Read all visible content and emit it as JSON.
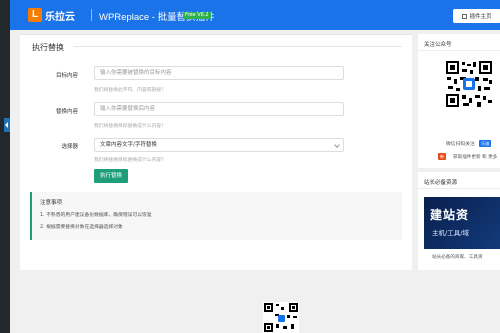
{
  "header": {
    "logo_mark": "L",
    "logo_text": "乐拉云",
    "title": "WPReplace - 批量替换插件",
    "version": "Free V6.2",
    "plugin_home_label": "插件主页"
  },
  "main": {
    "title": "执行替换",
    "fields": [
      {
        "label": "目标内容",
        "placeholder": "输入你需要被替换的目标内容",
        "hint": "我们将替换此字符、内容或链接？"
      },
      {
        "label": "替换内容",
        "placeholder": "输入你需要替换后内容",
        "hint": "我们将替换目标替换成什么内容？"
      }
    ],
    "selector": {
      "label": "选择器",
      "value": "文章内容文字/字符替换",
      "hint": "我们将替换目标替换成什么内容？"
    },
    "execute_label": "执行替换",
    "notice": {
      "title": "注意事项",
      "items": [
        "1. 不熟悉的用户建议备份数据库，确保错误可以恢复",
        "2. 根据需要替换对象在选择器选择对象"
      ]
    }
  },
  "sidebar": {
    "wechat": {
      "title": "关注公众号",
      "follow_text": "微信扫码关注",
      "follow_badge": "乐维",
      "new_tag": "新",
      "desc": "获取插件更新 和 更多"
    },
    "resources": {
      "title": "站长必备资源",
      "banner_big": "建站资",
      "banner_small": "主机/工具/域",
      "desc": "站长必备的商家、工具资"
    }
  },
  "colors": {
    "header_bg": "#1a73e8",
    "execute_button": "#1e9e7b",
    "version_badge": "#2bb24c",
    "new_tag": "#e64a19"
  }
}
